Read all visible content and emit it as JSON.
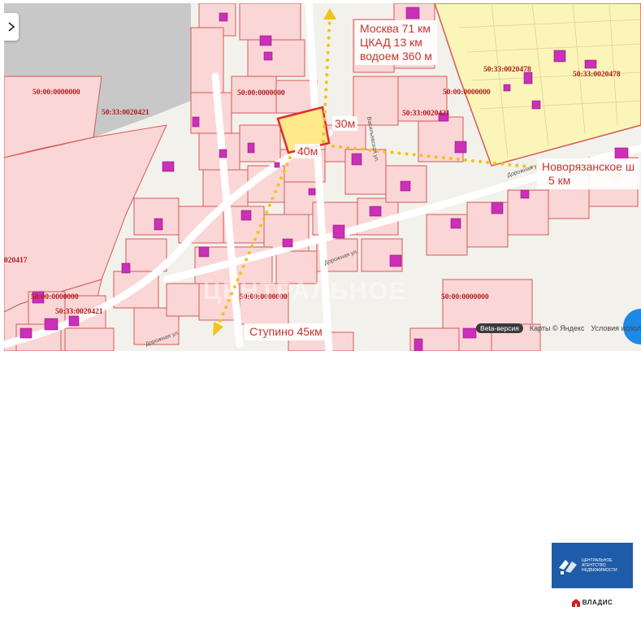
{
  "map": {
    "callouts": {
      "north": [
        "Москва 71 км",
        "ЦКАД 13 км",
        "водоем 360 м"
      ],
      "east": [
        "Новорязанское ш",
        "5 км"
      ],
      "south": "Ступино 45км"
    },
    "plot": {
      "width_label": "30м",
      "depth_label": "40м"
    },
    "cadastral_labels": [
      "50:00:0000000",
      "50:33:0020421",
      "50:00:0000000",
      "50:33:0020421",
      "50:00:0000000",
      "50:33:0020478",
      "50:33:0020478",
      "020417",
      "50:00:0000000",
      "50:33:0020421",
      "50:00:0000000",
      "50:00:0000000"
    ],
    "street_labels": [
      "Дорожная ул.",
      "Дорожная ул.",
      "Васильевская ул.",
      "Дорожная ул."
    ],
    "watermark": "ЦЕНТРАЛЬНОЕ",
    "attribution": {
      "beta": "Beta-версия",
      "maps": "Карты © Яндекс",
      "terms": "Условия испол"
    },
    "colors": {
      "parcel_fill": "#fbd6d6",
      "parcel_stroke": "#d45a5a",
      "building": "#cc2fb8",
      "highlight_plot": "#ffe98a",
      "highlight_stroke": "#e32b2b",
      "yellow_zone": "#fbf6b8",
      "route_dots": "#f2c417",
      "callout_text": "#c8332b",
      "cad_label": "#b0191b"
    }
  },
  "branding": {
    "agency_text": "Центральное агентство недвижимости",
    "brand": "ВЛАДИС"
  },
  "icons": {
    "expand": "chevron-right-icon",
    "logo_mark": "agency-logo-icon",
    "brand_mark": "vladis-house-icon"
  }
}
